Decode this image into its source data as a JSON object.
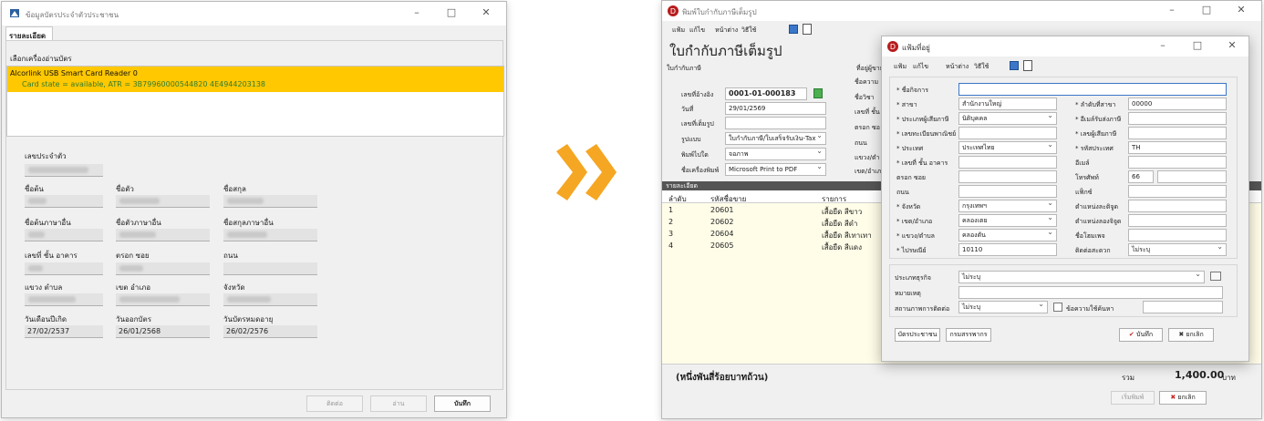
{
  "left_window": {
    "title": "ข้อมูลบัตรประจำตัวประชาชน",
    "tab": "รายละเอียด",
    "reader_group_label": "เลือกเครื่องอ่านบัตร",
    "reader_name": "Alcorlink USB Smart Card Reader 0",
    "reader_state": "Card state = available, ATR = 3B79960000544820 4E4944203138",
    "fields": {
      "id_label": "เลขประจำตัว",
      "prefix_label": "ชื่อต้น",
      "firstname_label": "ชื่อตัว",
      "lastname_label": "ชื่อสกุล",
      "prefix_en_label": "ชื่อต้นภาษาอื่น",
      "firstname_en_label": "ชื่อตัวภาษาอื่น",
      "lastname_en_label": "ชื่อสกุลภาษาอื่น",
      "houseno_label": "เลขที่ ชั้น อาคาร",
      "alley_label": "ตรอก ซอย",
      "road_label": "ถนน",
      "subdistrict_label": "แขวง ตำบล",
      "district_label": "เขต อำเภอ",
      "province_label": "จังหวัด",
      "birth_label": "วันเดือนปีเกิด",
      "issue_label": "วันออกบัตร",
      "expire_label": "วันบัตรหมดอายุ",
      "birth_value": "27/02/2537",
      "issue_value": "26/01/2568",
      "expire_value": "26/02/2576"
    },
    "buttons": {
      "connect": "ติดต่อ",
      "read": "อ่าน",
      "save": "บันทึก"
    }
  },
  "arrow_color": "#f5a623",
  "right_window": {
    "title": "พิมพ์ใบกำกับภาษีเต็มรูป",
    "menu": [
      "แฟ้ม",
      "แก้ไข",
      "หน้าต่าง",
      "วิธีใช้"
    ],
    "heading": "ใบกำกับภาษีเต็มรูป",
    "group_label": "ใบกำกับภาษี",
    "group_label2": "ที่อยู่ผู้ขาย",
    "doc_no_label": "เลขที่อ้างอิง",
    "doc_no_value": "0001-01-000183",
    "date_label": "วันที่",
    "date_value": "29/01/2569",
    "fullref_label": "เลขที่เต็มรูป",
    "format_label": "รูปแบบ",
    "format_value": "ใบกำกับภาษี/ใบเสร็จรับเงิน-Tax",
    "print_to_label": "พิมพ์ไปใด",
    "print_to_value": "จอภาพ",
    "printer_label": "ชื่อเครื่องพิมพ์",
    "printer_value": "Microsoft Print to PDF",
    "side_labels": [
      "ชื่อความ",
      "ชื่อวิชา",
      "เลขที่ ชั้น",
      "ตรอก ซอ",
      "ถนน",
      "แขวง/ตำ",
      "เขต/อำเภ"
    ],
    "detail_bar": "รายละเอียด",
    "columns": [
      "ลำดับ",
      "รหัสชื่อขาย",
      "รายการ"
    ],
    "rows": [
      {
        "no": "1",
        "code": "20601",
        "item": "เสื้อยืด สีขาว"
      },
      {
        "no": "2",
        "code": "20602",
        "item": "เสื้อยืด สีดำ"
      },
      {
        "no": "3",
        "code": "20604",
        "item": "เสื้อยืด สีเทาเทา"
      },
      {
        "no": "4",
        "code": "20605",
        "item": "เสื้อยืด สีแดง"
      }
    ],
    "amount_words": "(หนึ่งพันสี่ร้อยบาทถ้วน)",
    "total_label": "รวม",
    "total_value": "1,400.00",
    "currency": "บาท",
    "start_print": "เริ่มพิมพ์",
    "cancel": "ยกเลิก"
  },
  "dialog": {
    "title": "แฟ้มที่อยู่",
    "menu": [
      "แฟ้ม",
      "แก้ไข",
      "หน้าต่าง",
      "วิธีใช้"
    ],
    "left_fields": [
      {
        "label": "* ชื่อกิจการ",
        "value": ""
      },
      {
        "label": "* สาขา",
        "value": "สำนักงานใหญ่"
      },
      {
        "label": "* ประเภทผู้เสียภาษี",
        "value": "นิติบุคคล"
      },
      {
        "label": "* เลขทะเบียนพาณิชย์",
        "value": ""
      },
      {
        "label": "* ประเทศ",
        "value": "ประเทศไทย"
      },
      {
        "label": "* เลขที่ ชั้น อาคาร",
        "value": ""
      },
      {
        "label": "ตรอก ซอย",
        "value": ""
      },
      {
        "label": "ถนน",
        "value": ""
      },
      {
        "label": "* จังหวัด",
        "value": "กรุงเทพฯ"
      },
      {
        "label": "* เขต/อำเภอ",
        "value": "คลองเตย"
      },
      {
        "label": "* แขวง/ตำบล",
        "value": "คลองตัน"
      },
      {
        "label": "* ไปรษณีย์",
        "value": "10110"
      }
    ],
    "right_fields": [
      {
        "label": "* ลำดับที่สาขา",
        "value": "00000"
      },
      {
        "label": "* อีเมล์รับส่งภาษี",
        "value": ""
      },
      {
        "label": "* เลขผู้เสียภาษี",
        "value": ""
      },
      {
        "label": "* รหัสประเทศ",
        "value": "TH"
      },
      {
        "label": "อีเมล์",
        "value": ""
      },
      {
        "label": "โทรศัพท์",
        "value": "66"
      },
      {
        "label": "แฟ็กซ์",
        "value": ""
      },
      {
        "label": "ตำแหน่งละติจูด",
        "value": ""
      },
      {
        "label": "ตำแหน่งลองจิจูด",
        "value": ""
      },
      {
        "label": "ชื่อโฮมเพจ",
        "value": ""
      },
      {
        "label": "ติดต่อสะดวก",
        "value": "ไม่ระบุ"
      }
    ],
    "business_type_label": "ประเภทธุรกิจ",
    "business_type_value": "ไม่ระบุ",
    "remark_label": "หมายเหตุ",
    "contact_status_label": "สถานภาพการติดต่อ",
    "contact_status_value": "ไม่ระบุ",
    "search_msg_label": "ข้อความใช้ค้นหา",
    "id_card_button": "บัตรประชาชน",
    "revenue_button": "กรมสรรพากร",
    "save_button": "บันทึก",
    "cancel_button": "ยกเลิก"
  }
}
